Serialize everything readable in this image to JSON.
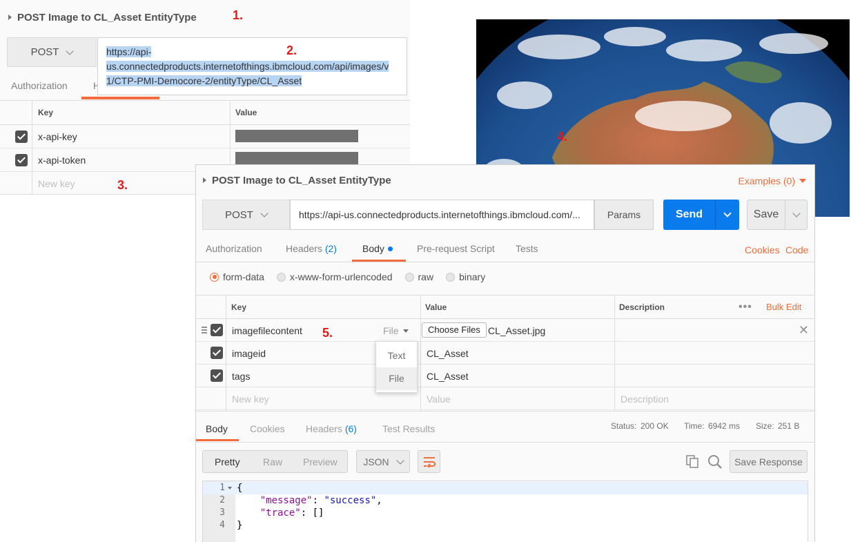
{
  "annotations": {
    "a1": "1.",
    "a2": "2.",
    "a3": "3.",
    "a4": "4.",
    "a5": "5."
  },
  "back_window": {
    "request_title": "POST Image to CL_Asset EntityType",
    "method": "POST",
    "url_lines": [
      "https://api-",
      "us.connectedproducts.internetofthings.ibmcloud.com/api/images/v",
      "1/CTP-PMI-Democore-2/entityType/CL_Asset"
    ],
    "tabs": {
      "authorization": "Authorization",
      "headers_partial": "H"
    },
    "headers_table": {
      "columns": {
        "key": "Key",
        "value": "Value"
      },
      "rows": [
        {
          "key": "x-api-key"
        },
        {
          "key": "x-api-token"
        }
      ],
      "new_key_placeholder": "New key"
    }
  },
  "main_window": {
    "request_title": "POST Image to CL_Asset EntityType",
    "examples": "Examples (0)",
    "method": "POST",
    "url": "https://api-us.connectedproducts.internetofthings.ibmcloud.com/...",
    "params": "Params",
    "send": "Send",
    "save": "Save",
    "tabs": {
      "authorization": "Authorization",
      "headers": "Headers",
      "headers_count": "(2)",
      "body": "Body",
      "prerequest": "Pre-request Script",
      "tests": "Tests"
    },
    "cookies_link": "Cookies",
    "code_link": "Code",
    "body_modes": {
      "form_data": "form-data",
      "urlencoded": "x-www-form-urlencoded",
      "raw": "raw",
      "binary": "binary"
    },
    "form_table": {
      "columns": {
        "key": "Key",
        "value": "Value",
        "description": "Description"
      },
      "bulk_edit": "Bulk Edit",
      "rows": [
        {
          "key": "imagefilecontent",
          "type": "File",
          "choose_files": "Choose Files",
          "value": "CL_Asset.jpg"
        },
        {
          "key": "imageid",
          "value": "CL_Asset"
        },
        {
          "key": "tags",
          "value": "CL_Asset"
        }
      ],
      "placeholders": {
        "key": "New key",
        "value": "Value",
        "description": "Description"
      },
      "type_menu": [
        "Text",
        "File"
      ]
    },
    "response": {
      "tabs": {
        "body": "Body",
        "cookies": "Cookies",
        "headers": "Headers",
        "headers_count": "(6)",
        "test_results": "Test Results"
      },
      "status_label": "Status:",
      "status_value": "200 OK",
      "time_label": "Time:",
      "time_value": "6942 ms",
      "size_label": "Size:",
      "size_value": "251 B",
      "views": {
        "pretty": "Pretty",
        "raw": "Raw",
        "preview": "Preview"
      },
      "format": "JSON",
      "save_response": "Save Response",
      "code_lines": [
        {
          "n": "1",
          "text": "{"
        },
        {
          "n": "2",
          "key": "\"message\"",
          "sep": ": ",
          "val": "\"success\"",
          "end": ","
        },
        {
          "n": "3",
          "key": "\"trace\"",
          "sep": ": ",
          "plain": "[]"
        },
        {
          "n": "4",
          "text": "}"
        }
      ]
    }
  },
  "colors": {
    "accent": "#f26b3a",
    "link_blue": "#097bed",
    "annotation_red": "#e01b1b"
  },
  "icons": [
    "caret-right-icon",
    "chevron-down-icon",
    "close-icon",
    "more-icon",
    "wrap-lines-icon",
    "copy-icon",
    "search-icon",
    "drag-handle-icon"
  ]
}
